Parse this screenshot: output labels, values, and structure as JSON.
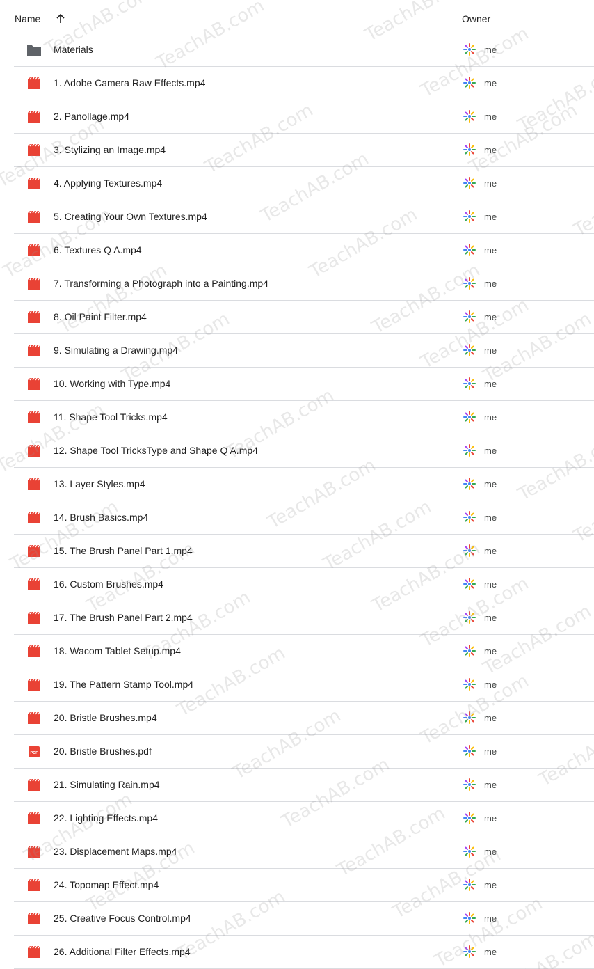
{
  "header": {
    "name_label": "Name",
    "owner_label": "Owner",
    "sort_icon": "arrow-up-icon"
  },
  "files": [
    {
      "name": "Materials",
      "type": "folder",
      "owner": "me"
    },
    {
      "name": "1. Adobe Camera Raw Effects.mp4",
      "type": "video",
      "owner": "me"
    },
    {
      "name": "2. Panollage.mp4",
      "type": "video",
      "owner": "me"
    },
    {
      "name": "3. Stylizing an Image.mp4",
      "type": "video",
      "owner": "me"
    },
    {
      "name": "4. Applying Textures.mp4",
      "type": "video",
      "owner": "me"
    },
    {
      "name": "5. Creating Your Own Textures.mp4",
      "type": "video",
      "owner": "me"
    },
    {
      "name": "6. Textures Q A.mp4",
      "type": "video",
      "owner": "me"
    },
    {
      "name": "7. Transforming a Photograph into a Painting.mp4",
      "type": "video",
      "owner": "me"
    },
    {
      "name": "8. Oil Paint Filter.mp4",
      "type": "video",
      "owner": "me"
    },
    {
      "name": "9. Simulating a Drawing.mp4",
      "type": "video",
      "owner": "me"
    },
    {
      "name": "10. Working with Type.mp4",
      "type": "video",
      "owner": "me"
    },
    {
      "name": "11. Shape Tool Tricks.mp4",
      "type": "video",
      "owner": "me"
    },
    {
      "name": "12. Shape Tool TricksType and Shape Q A.mp4",
      "type": "video",
      "owner": "me"
    },
    {
      "name": "13. Layer Styles.mp4",
      "type": "video",
      "owner": "me"
    },
    {
      "name": "14. Brush Basics.mp4",
      "type": "video",
      "owner": "me"
    },
    {
      "name": "15. The Brush Panel Part 1.mp4",
      "type": "video",
      "owner": "me"
    },
    {
      "name": "16. Custom Brushes.mp4",
      "type": "video",
      "owner": "me"
    },
    {
      "name": "17. The Brush Panel Part 2.mp4",
      "type": "video",
      "owner": "me"
    },
    {
      "name": "18. Wacom Tablet Setup.mp4",
      "type": "video",
      "owner": "me"
    },
    {
      "name": "19. The Pattern Stamp Tool.mp4",
      "type": "video",
      "owner": "me"
    },
    {
      "name": "20. Bristle Brushes.mp4",
      "type": "video",
      "owner": "me"
    },
    {
      "name": "20. Bristle Brushes.pdf",
      "type": "pdf",
      "owner": "me"
    },
    {
      "name": "21. Simulating Rain.mp4",
      "type": "video",
      "owner": "me"
    },
    {
      "name": "22. Lighting Effects.mp4",
      "type": "video",
      "owner": "me"
    },
    {
      "name": "23. Displacement Maps.mp4",
      "type": "video",
      "owner": "me"
    },
    {
      "name": "24. Topomap Effect.mp4",
      "type": "video",
      "owner": "me"
    },
    {
      "name": "25. Creative Focus Control.mp4",
      "type": "video",
      "owner": "me"
    },
    {
      "name": "26. Additional Filter Effects.mp4",
      "type": "video",
      "owner": "me"
    }
  ],
  "watermark": "TeachAB.com",
  "colors": {
    "video_icon": "#e94235",
    "folder_icon": "#5f6368",
    "pdf_icon": "#ea4335",
    "divider": "#dadce0"
  }
}
